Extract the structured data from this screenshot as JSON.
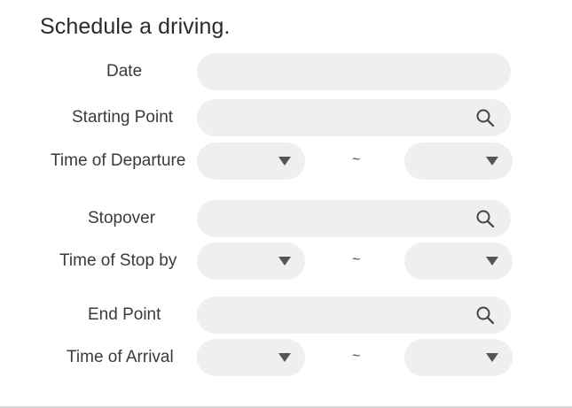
{
  "form": {
    "title": "Schedule a driving.",
    "date": {
      "label": "Date",
      "value": ""
    },
    "starting_point": {
      "label": "Starting Point",
      "value": ""
    },
    "time_of_departure": {
      "label": "Time of Departure",
      "from": "",
      "to": "",
      "separator": "~"
    },
    "stopover": {
      "label": "Stopover",
      "value": ""
    },
    "time_of_stop_by": {
      "label": "Time of Stop by",
      "from": "",
      "to": "",
      "separator": "~"
    },
    "end_point": {
      "label": "End Point",
      "value": ""
    },
    "time_of_arrival": {
      "label": "Time of Arrival",
      "from": "",
      "to": "",
      "separator": "~"
    }
  },
  "icons": {
    "search": "search-icon",
    "dropdown": "chevron-down-icon"
  },
  "colors": {
    "field_background": "#efefef",
    "text": "#3a3a3a",
    "icon": "#555555"
  }
}
